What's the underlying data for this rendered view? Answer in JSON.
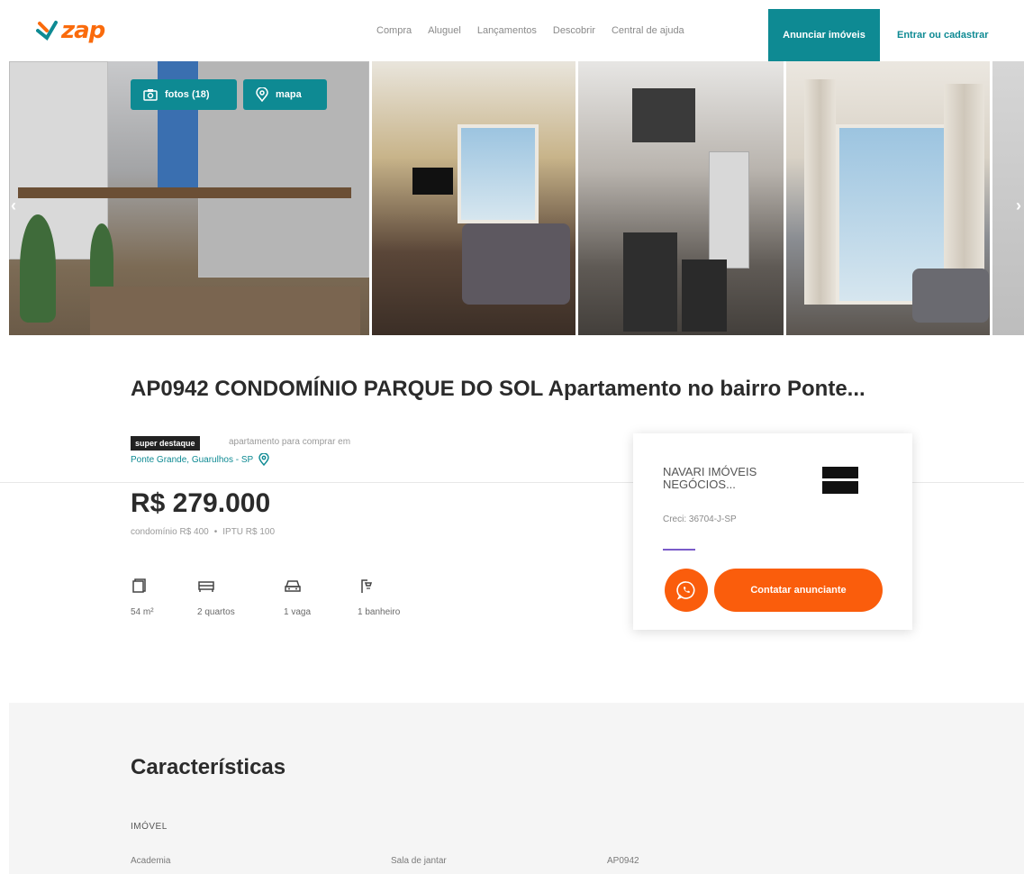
{
  "header": {
    "logo_text": "zap",
    "nav": [
      "Compra",
      "Aluguel",
      "Lançamentos",
      "Descobrir",
      "Central de ajuda"
    ],
    "anunciar_label": "Anunciar imóveis",
    "entrar_label": "Entrar ou cadastrar"
  },
  "gallery": {
    "fotos_label": "fotos (18)",
    "mapa_label": "mapa",
    "icons": [
      "photo-icon",
      "map-pin-icon",
      "chevron-left-icon",
      "chevron-right-icon"
    ]
  },
  "listing": {
    "title": "AP0942 CONDOMÍNIO PARQUE DO SOL Apartamento no bairro Ponte...",
    "badge": "super destaque",
    "type_text": "apartamento para comprar em",
    "location": "Ponte Grande, Guarulhos - SP",
    "price": "R$ 279.000",
    "condominio": "condomínio R$ 400",
    "fee_separator": "•",
    "iptu": "IPTU R$ 100",
    "amenities": [
      {
        "icon": "area-icon",
        "label": "54 m²"
      },
      {
        "icon": "bed-icon",
        "label": "2 quartos"
      },
      {
        "icon": "car-icon",
        "label": "1 vaga"
      },
      {
        "icon": "shower-icon",
        "label": "1 banheiro"
      }
    ]
  },
  "contact": {
    "advertiser": "NAVARI IMÓVEIS NEGÓCIOS...",
    "creci": "Creci: 36704-J-SP",
    "contact_label": "Contatar anunciante"
  },
  "features": {
    "title": "Características",
    "subtitle": "IMÓVEL",
    "items": [
      "Academia",
      "Sala de jantar",
      "AP0942"
    ]
  },
  "colors": {
    "brand_orange": "#fa5d0c",
    "teal": "#0e8a93",
    "dark_text": "#2b2b2b"
  }
}
